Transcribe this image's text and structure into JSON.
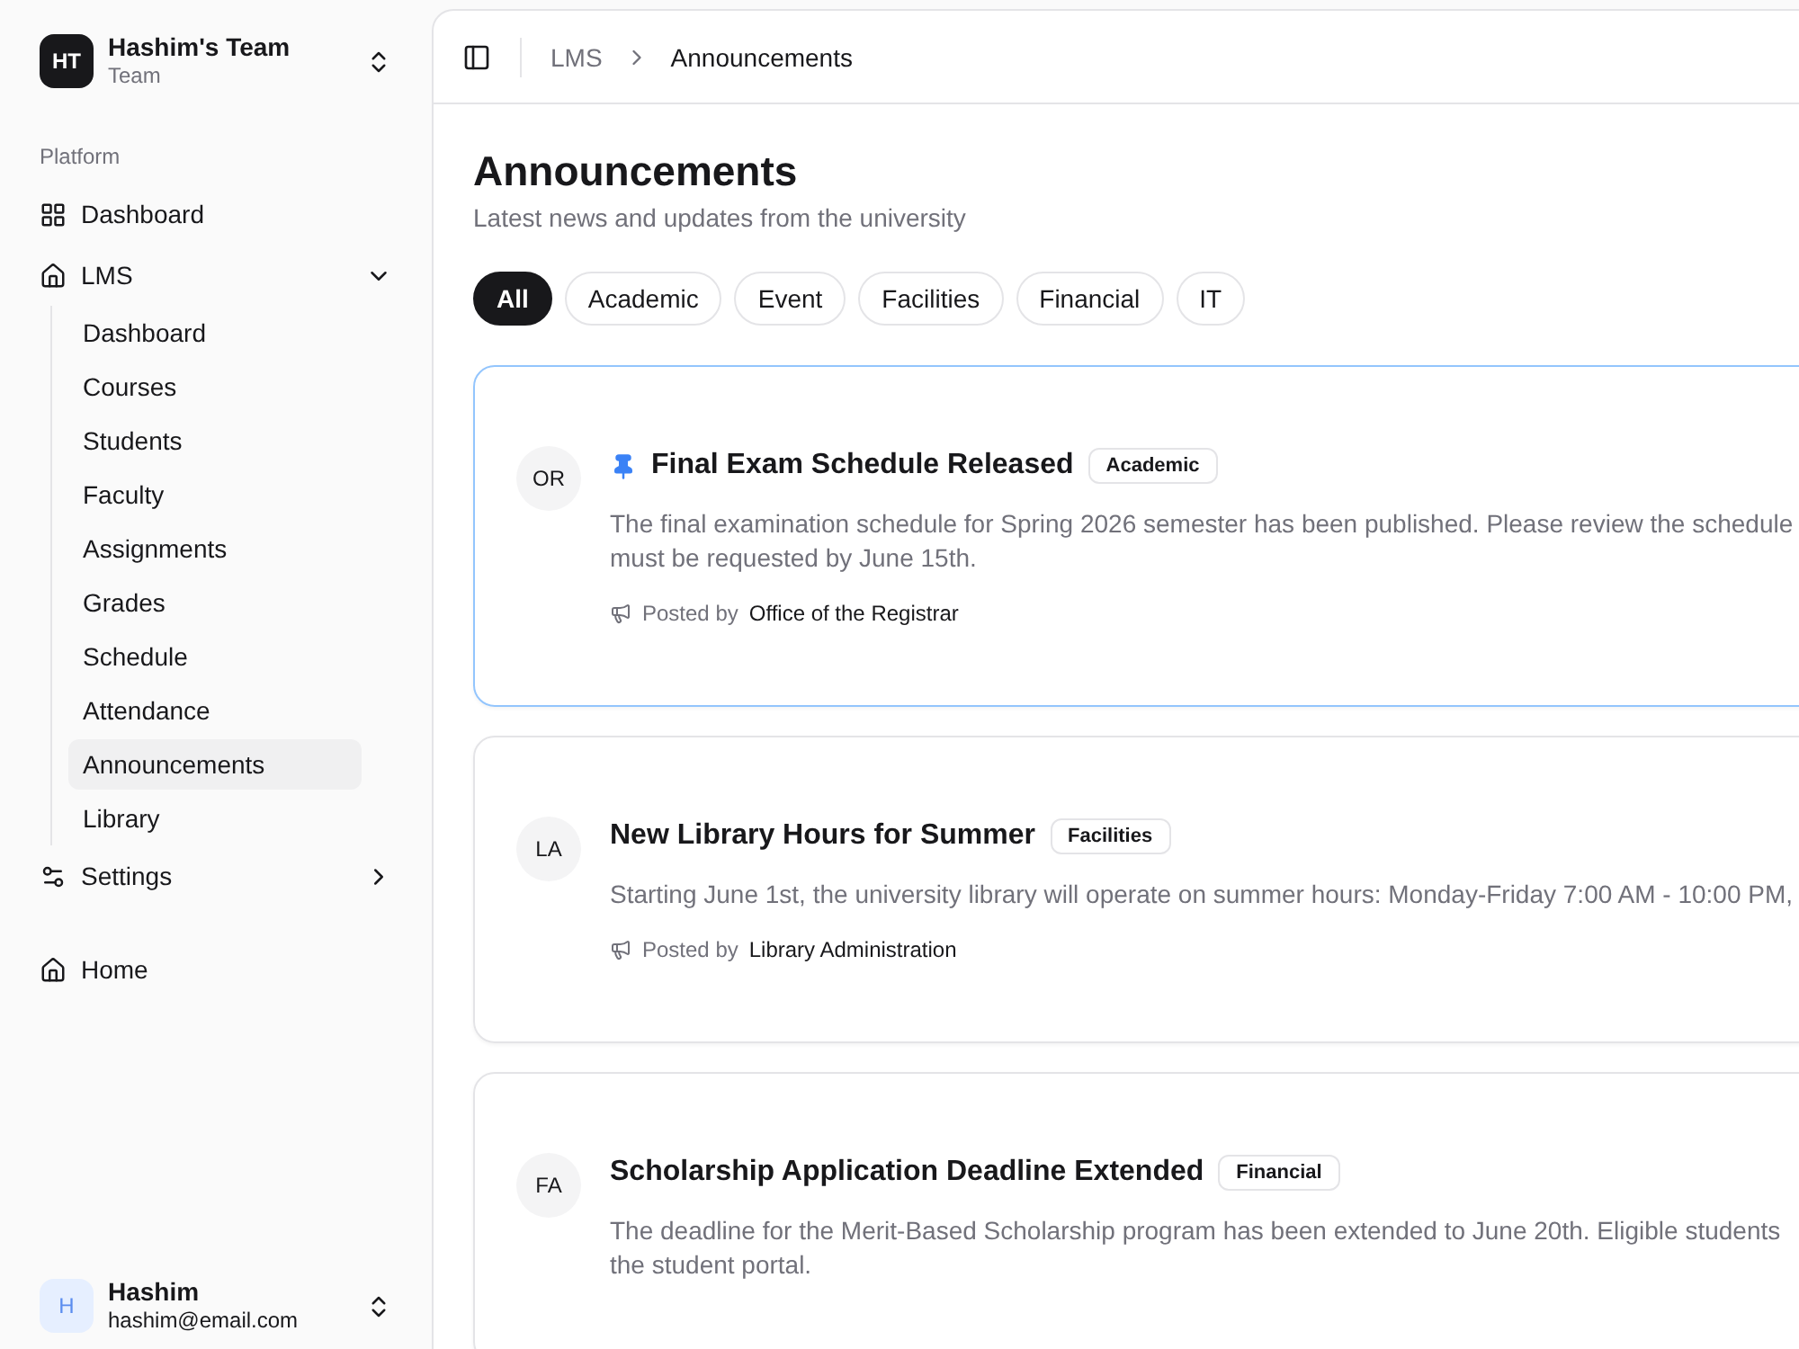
{
  "team": {
    "avatar": "HT",
    "name": "Hashim's Team",
    "plan": "Team"
  },
  "sidebar": {
    "group_label": "Platform",
    "items": [
      {
        "kind": "link",
        "label": "Dashboard"
      },
      {
        "kind": "group",
        "label": "LMS",
        "expanded": true,
        "children": [
          {
            "label": "Dashboard",
            "selected": false
          },
          {
            "label": "Courses",
            "selected": false
          },
          {
            "label": "Students",
            "selected": false
          },
          {
            "label": "Faculty",
            "selected": false
          },
          {
            "label": "Assignments",
            "selected": false
          },
          {
            "label": "Grades",
            "selected": false
          },
          {
            "label": "Schedule",
            "selected": false
          },
          {
            "label": "Attendance",
            "selected": false
          },
          {
            "label": "Announcements",
            "selected": true
          },
          {
            "label": "Library",
            "selected": false
          }
        ]
      },
      {
        "kind": "group",
        "label": "Settings",
        "expanded": false
      }
    ],
    "extra_items": [
      {
        "label": "Home"
      }
    ]
  },
  "user": {
    "avatar": "H",
    "name": "Hashim",
    "email": "hashim@email.com"
  },
  "breadcrumb": [
    {
      "label": "LMS",
      "current": false
    },
    {
      "label": "Announcements",
      "current": true
    }
  ],
  "page": {
    "title": "Announcements",
    "subtitle": "Latest news and updates from the university"
  },
  "filters": [
    {
      "label": "All",
      "selected": true
    },
    {
      "label": "Academic",
      "selected": false
    },
    {
      "label": "Event",
      "selected": false
    },
    {
      "label": "Facilities",
      "selected": false
    },
    {
      "label": "Financial",
      "selected": false
    },
    {
      "label": "IT",
      "selected": false
    }
  ],
  "announcements": [
    {
      "avatar": "OR",
      "pinned": true,
      "title": "Final Exam Schedule Released",
      "tag": "Academic",
      "lines": [
        "The final examination schedule for Spring 2026 semester has been published. Please review the schedule",
        "must be requested by June 15th."
      ],
      "posted_label": "Posted by",
      "author": "Office of the Registrar"
    },
    {
      "avatar": "LA",
      "pinned": false,
      "title": "New Library Hours for Summer",
      "tag": "Facilities",
      "lines": [
        "Starting June 1st, the university library will operate on summer hours: Monday-Friday 7:00 AM - 10:00 PM,"
      ],
      "posted_label": "Posted by",
      "author": "Library Administration"
    },
    {
      "avatar": "FA",
      "pinned": false,
      "title": "Scholarship Application Deadline Extended",
      "tag": "Financial",
      "lines": [
        "The deadline for the Merit-Based Scholarship program has been extended to June 20th. Eligible students",
        "the student portal."
      ]
    }
  ]
}
